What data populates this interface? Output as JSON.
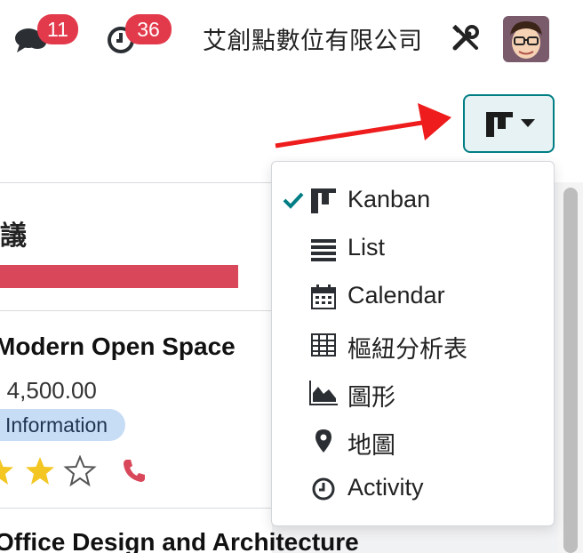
{
  "topbar": {
    "messages_count": "11",
    "activities_count": "36",
    "company_name": "艾創點數位有限公司",
    "icons": {
      "messages": "chat-bubbles-icon",
      "activities": "clock-icon",
      "settings": "tools-icon",
      "avatar": "user-avatar"
    }
  },
  "view_switcher": {
    "icon": "kanban-icon",
    "caret": "caret-down-icon"
  },
  "column": {
    "title": "議",
    "progress_color": "#d9485a"
  },
  "cards": [
    {
      "title": "Modern Open Space",
      "amount": "$ 4,500.00",
      "tag": "Information",
      "stars_filled": 2,
      "stars_total": 3
    },
    {
      "title": "Office Design and Architecture"
    }
  ],
  "view_menu": {
    "items": [
      {
        "label": "Kanban",
        "icon": "kanban-icon",
        "checked": true
      },
      {
        "label": "List",
        "icon": "list-icon",
        "checked": false
      },
      {
        "label": "Calendar",
        "icon": "calendar-icon",
        "checked": false
      },
      {
        "label": "樞紐分析表",
        "icon": "pivot-table-icon",
        "checked": false
      },
      {
        "label": "圖形",
        "icon": "area-chart-icon",
        "checked": false
      },
      {
        "label": "地圖",
        "icon": "map-marker-icon",
        "checked": false
      },
      {
        "label": "Activity",
        "icon": "clock-icon",
        "checked": false
      }
    ]
  },
  "colors": {
    "accent": "#017e84",
    "badge": "#e2394b",
    "arrow": "#ee1c1c",
    "star": "#f3c623",
    "phone": "#d9485a",
    "tag_bg": "#c7dcf5"
  }
}
